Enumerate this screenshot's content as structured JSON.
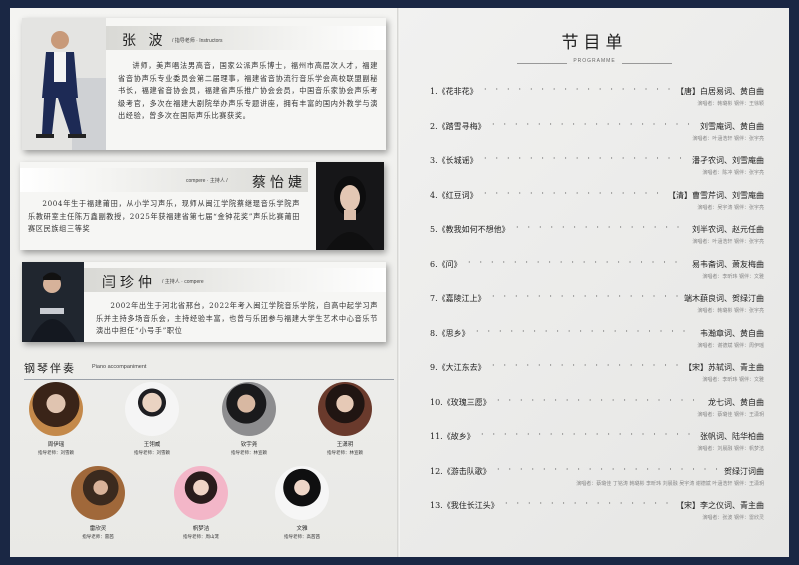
{
  "instructors": [
    {
      "name": "张 波",
      "role": "/ 指导老师 · Instructors",
      "bio": "讲师，美声唱法男高音，国家公派声乐博士，福州市高层次人才，福建省音协声乐专业委员会第二届理事，福建省音协流行音乐学会高校联盟副秘书长，福建省音协会员，福建省声乐推广协会会员，中国音乐家协会声乐考级考官，多次在福建大剧院举办声乐专题讲座，拥有丰富的国内外教学与演出经验，曾多次在国际声乐比赛获奖。"
    },
    {
      "name": "蔡怡婕",
      "role": "compere · 主持人 /",
      "bio": "2004年生于福建莆田，从小学习声乐，现师从闽江学院蔡继琨音乐学院声乐教研室主任陈万鑫副教授，2025年获福建省第七届“金钟花奖”声乐比赛莆田赛区民族组三等奖"
    },
    {
      "name": "闫珍仲",
      "role": "/ 主持人 · compere",
      "bio": "2002年出生于河北省邢台，2022年考入闽江学院音乐学院，自高中起学习声乐并主持多场音乐会，主持经验丰富，也曾与乐团参与福建大学生艺术中心音乐节演出中担任“小号手”职位"
    }
  ],
  "accompaniment": {
    "title": "钢琴伴奏",
    "subtitle": "Piano accompaniment",
    "people": [
      {
        "name": "周伊瑶",
        "teacher": "指导老师：刘雪颖"
      },
      {
        "name": "王翎威",
        "teacher": "指导老师：刘雪颖"
      },
      {
        "name": "钦宇尧",
        "teacher": "指导老师：林宣颖"
      },
      {
        "name": "王潇玥",
        "teacher": "指导老师：林宣颖"
      },
      {
        "name": "雷欣灵",
        "teacher": "指导老师：雷茜"
      },
      {
        "name": "帆梦洁",
        "teacher": "指导老师：周山茏"
      },
      {
        "name": "文雅",
        "teacher": "指导老师：高茜茜"
      }
    ]
  },
  "programme": {
    "title": "节目单",
    "subtitle": "PROGRAMME",
    "items": [
      {
        "title": "1.《花非花》",
        "author": "【唐】白居易词、黄自曲",
        "performers": "演唱者：韩璐彬  钢伴：王徐颖"
      },
      {
        "title": "2.《踏雪寻梅》",
        "author": "刘雪庵词、黄自曲",
        "performers": "演唱者：叶涵浩轩  钢伴：张宇亮"
      },
      {
        "title": "3.《长城谣》",
        "author": "潘孑农词、刘雪庵曲",
        "performers": "演唱者：陈冲  钢伴：张宇亮"
      },
      {
        "title": "4.《红豆词》",
        "author": "【清】曹雪芹词、刘雪庵曲",
        "performers": "演唱者：吴宇涛  钢伴：张宇亮"
      },
      {
        "title": "5.《教我如何不想他》",
        "author": "刘半农词、赵元任曲",
        "performers": "演唱者：叶涵浩轩  钢伴：张宇亮"
      },
      {
        "title": "6.《问》",
        "author": "易韦斋词、萧友梅曲",
        "performers": "演唱者：李昕玮  钢伴：文雅"
      },
      {
        "title": "7.《嘉陵江上》",
        "author": "端木蕻良词、贺绿汀曲",
        "performers": "演唱者：韩璐彬  钢伴：张宇亮"
      },
      {
        "title": "8.《思乡》",
        "author": "韦瀚章词、黄自曲",
        "performers": "演唱者：谢德斌  钢伴：周伊瑶"
      },
      {
        "title": "9.《大江东去》",
        "author": "【宋】苏轼词、青主曲",
        "performers": "演唱者：李昕玮  钢伴：文雅"
      },
      {
        "title": "10.《玫瑰三愿》",
        "author": "龙七词、黄自曲",
        "performers": "演唱者：蔡璐佳  钢伴：王潇玥"
      },
      {
        "title": "11.《故乡》",
        "author": "张帆词、陆华柏曲",
        "performers": "演唱者：刘晨融  钢伴：帆梦洁"
      },
      {
        "title": "12.《游击队歌》",
        "author": "贺绿汀词曲",
        "performers": "演唱者：蔡璐佳 丁铭涛 韩璐彬 李昕玮 刘晨融 吴宇涛 谢德斌 叶涵浩轩  钢伴：王潇玥"
      },
      {
        "title": "13.《我住长江头》",
        "author": "【宋】李之仪词、青主曲",
        "performers": "演唱者：张波  钢伴：雷欣灵"
      }
    ]
  }
}
